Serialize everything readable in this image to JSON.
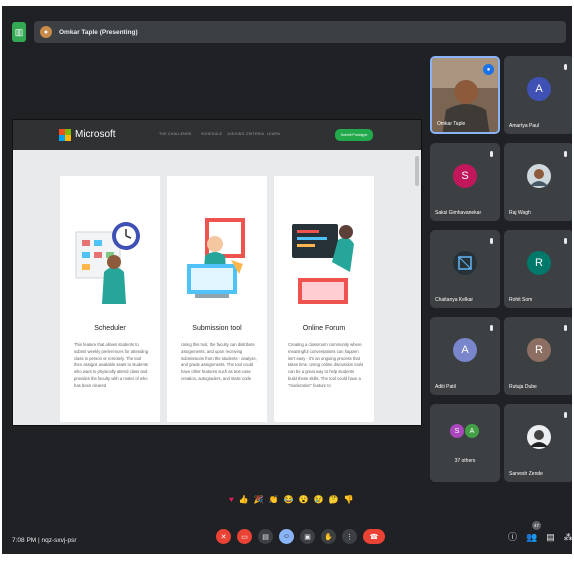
{
  "topbar": {
    "presenter_label": "Omkar Taple (Presenting)",
    "layout_icon": "layout-icon",
    "layout_color": "#34a853"
  },
  "shared_screen": {
    "site": {
      "brand": "Microsoft",
      "nav_links": [
        "THE CHALLENGE",
        "SCHEDULE",
        "JUDGING CRITERIA",
        "LEARN"
      ],
      "submit_button": "Submit Prototype",
      "submit_color": "#22a94b"
    },
    "cards": [
      {
        "title": "Scheduler",
        "body": "This feature that allows students to submit weekly preferences for attending class in person or remotely. The tool then assigns available seats to students who want to physically attend class and provides the faculty with a roster of who has been cleared"
      },
      {
        "title": "Submission tool",
        "body": "Using this tool, the faculty can distribute assignments, and upon receiving submissions from the students - analyze, and grade assignments. The tool could have other features such as text-case creation, autograders, and static code"
      },
      {
        "title": "Online Forum",
        "body": "Creating a classroom community where meaningful conversations can happen isn't easy - it's an ongoing process that takes time. Using online discussion tools can be a great way to help students build these skills. The tool could have a \"moderation\" feature to"
      }
    ]
  },
  "participants": [
    {
      "name": "Omkar Taple",
      "type": "video"
    },
    {
      "name": "Amartya Paul",
      "initial": "A",
      "color": "#3f51b5"
    },
    {
      "name": "Saksi Gimhavanekar",
      "initial": "S",
      "color": "#c2185b"
    },
    {
      "name": "Raj Wagh",
      "type": "photo"
    },
    {
      "name": "Chaitanya Kelkar",
      "type": "photo"
    },
    {
      "name": "Rohit Som",
      "initial": "R",
      "color": "#00796b"
    },
    {
      "name": "Aditi Patil",
      "initial": "A",
      "color": "#7986cb"
    },
    {
      "name": "Rutuja Dube",
      "initial": "R",
      "color": "#8d6e63"
    },
    {
      "name": "37 others",
      "initials": [
        "S",
        "A"
      ],
      "colors": [
        "#ab47bc",
        "#43a047"
      ]
    },
    {
      "name": "Sarvesh Zende",
      "type": "photo"
    }
  ],
  "reactions": [
    "♥",
    "👍",
    "🎉",
    "👏",
    "😂",
    "😮",
    "😢",
    "🤔",
    "👎"
  ],
  "bottom": {
    "meeting_info": "7:08 PM | nqz-sxvj-psr",
    "people_count": "47",
    "end_call_color": "#ea4335"
  }
}
